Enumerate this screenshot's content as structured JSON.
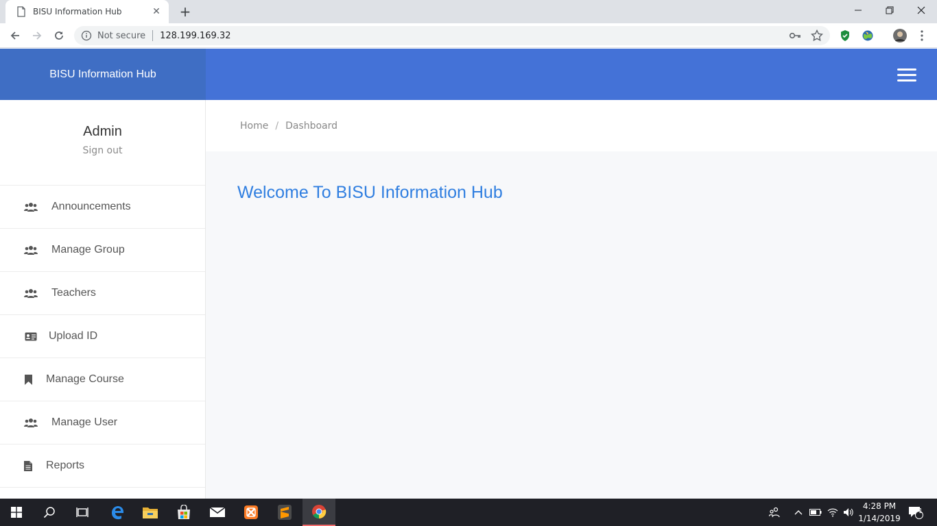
{
  "browser": {
    "tab_title": "BISU Information Hub",
    "security_label": "Not secure",
    "url": "128.199.169.32"
  },
  "app": {
    "brand": "BISU Information Hub"
  },
  "sidebar": {
    "username": "Admin",
    "signout": "Sign out",
    "items": [
      {
        "label": "Announcements",
        "icon": "users-icon"
      },
      {
        "label": "Manage Group",
        "icon": "users-icon"
      },
      {
        "label": "Teachers",
        "icon": "users-icon"
      },
      {
        "label": "Upload ID",
        "icon": "id-card-icon"
      },
      {
        "label": "Manage Course",
        "icon": "bookmark-icon"
      },
      {
        "label": "Manage User",
        "icon": "users-icon"
      },
      {
        "label": "Reports",
        "icon": "file-icon"
      }
    ]
  },
  "breadcrumb": {
    "home": "Home",
    "separator": "/",
    "current": "Dashboard"
  },
  "main": {
    "welcome": "Welcome To BISU Information Hub"
  },
  "taskbar": {
    "time": "4:28 PM",
    "date": "1/14/2019",
    "notification_count": "1"
  },
  "colors": {
    "brand_bg": "#3f6ec4",
    "topbar_bg": "#4472d7",
    "welcome_text": "#2f7ee0"
  }
}
